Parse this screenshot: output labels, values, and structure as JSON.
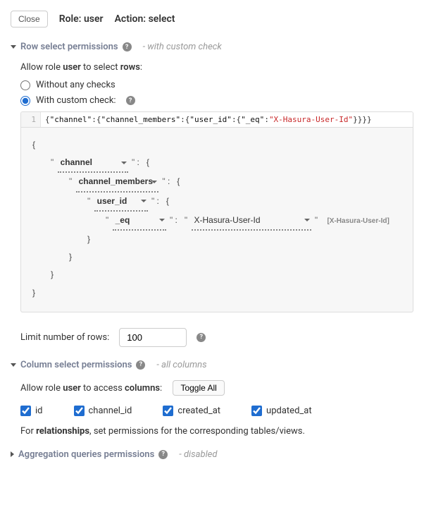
{
  "header": {
    "close": "Close",
    "role_label": "Role: user",
    "action_label": "Action: select"
  },
  "row_perm": {
    "title": "Row select permissions",
    "status": "- with custom check",
    "allow_text_pre": "Allow role ",
    "allow_role": "user",
    "allow_text_mid": " to select ",
    "allow_target": "rows",
    "radio_none": "Without any checks",
    "radio_custom": "With custom check:",
    "code_raw": "{\"channel\":{\"channel_members\":{\"user_id\":{\"_eq\":\"X-Hasura-User-Id\"}}}}",
    "builder": {
      "lv1": "channel",
      "lv2": "channel_members",
      "lv3": "user_id",
      "lv4_op": "_eq",
      "lv4_val": "X-Hasura-User-Id",
      "lv4_hint": "[X-Hasura-User-Id]"
    },
    "limit_label": "Limit number of rows:",
    "limit_value": "100"
  },
  "col_perm": {
    "title": "Column select permissions",
    "status": "- all columns",
    "allow_pre": "Allow role ",
    "allow_role": "user",
    "allow_mid": " to access ",
    "allow_target": "columns",
    "toggle": "Toggle All",
    "columns": [
      "id",
      "channel_id",
      "created_at",
      "updated_at"
    ],
    "rel_pre": "For ",
    "rel_bold": "relationships",
    "rel_post": ", set permissions for the corresponding tables/views."
  },
  "agg_perm": {
    "title": "Aggregation queries permissions",
    "status": "- disabled"
  }
}
